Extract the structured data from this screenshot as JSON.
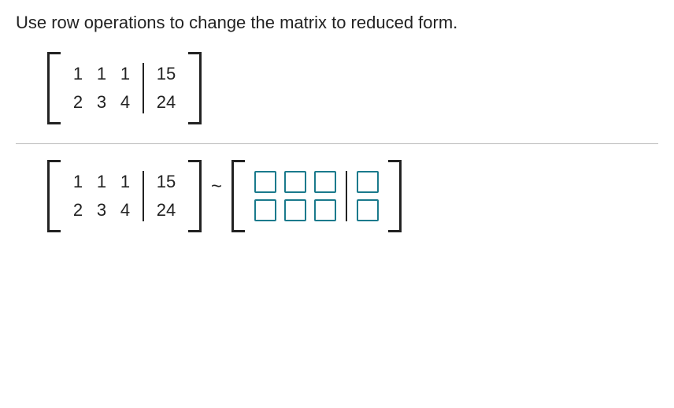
{
  "prompt": "Use row operations to change the matrix to reduced form.",
  "matrix_given": {
    "rows": [
      {
        "left": [
          "1",
          "1",
          "1"
        ],
        "right": "15"
      },
      {
        "left": [
          "2",
          "3",
          "4"
        ],
        "right": "24"
      }
    ]
  },
  "matrix_repeat": {
    "rows": [
      {
        "left": [
          "1",
          "1",
          "1"
        ],
        "right": "15"
      },
      {
        "left": [
          "2",
          "3",
          "4"
        ],
        "right": "24"
      }
    ]
  },
  "tilde": "~",
  "answer_grid": {
    "rows": 2,
    "left_cols": 3,
    "right_cols": 1
  }
}
